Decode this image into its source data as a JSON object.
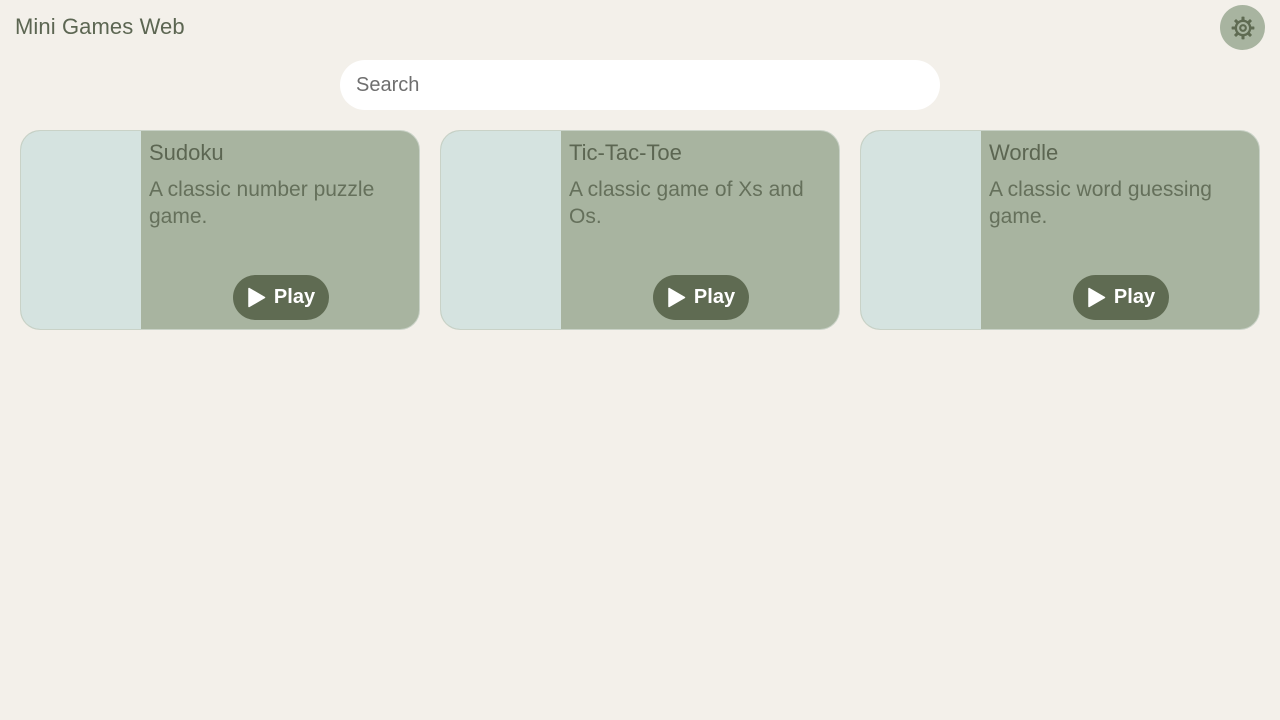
{
  "header": {
    "title": "Mini Games Web",
    "settings_icon": "gear-icon"
  },
  "search": {
    "placeholder": "Search",
    "value": ""
  },
  "colors": {
    "background": "#f3f0ea",
    "card": "#a8b4a0",
    "thumbnail": "#d5e3e0",
    "play_button": "#5f6b52",
    "text": "#5c6652"
  },
  "games": [
    {
      "title": "Sudoku",
      "description": "A classic number puzzle game.",
      "play_label": "Play",
      "play_icon": "play-icon"
    },
    {
      "title": "Tic-Tac-Toe",
      "description": "A classic game of Xs and Os.",
      "play_label": "Play",
      "play_icon": "play-icon"
    },
    {
      "title": "Wordle",
      "description": "A classic word guessing game.",
      "play_label": "Play",
      "play_icon": "play-icon"
    }
  ]
}
